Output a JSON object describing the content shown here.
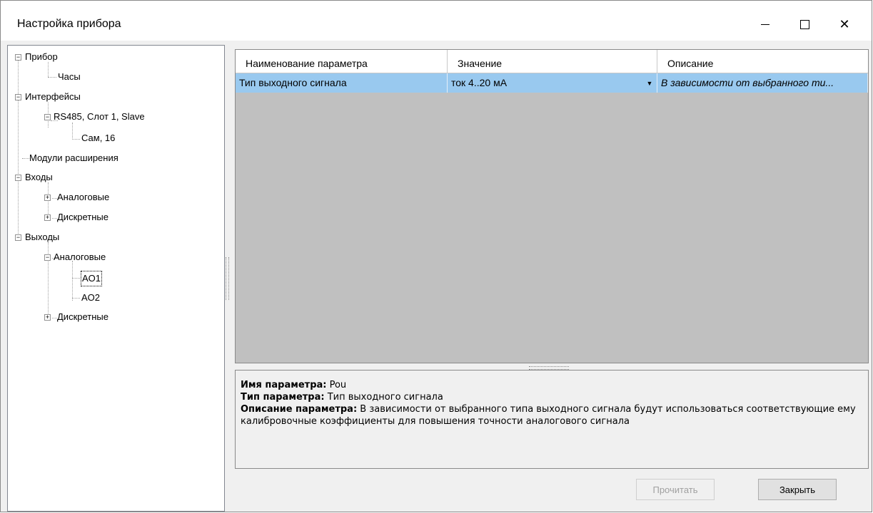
{
  "window": {
    "title": "Настройка прибора"
  },
  "tree": [
    {
      "label": "Прибор",
      "expander": "−"
    },
    {
      "label": "Часы"
    },
    {
      "label": "Интерфейсы",
      "expander": "−"
    },
    {
      "label": "RS485, Слот 1, Slave",
      "expander": "−"
    },
    {
      "label": "Сам, 16"
    },
    {
      "label": "Модули расширения"
    },
    {
      "label": "Входы",
      "expander": "−"
    },
    {
      "label": "Аналоговые",
      "expander": "+"
    },
    {
      "label": "Дискретные",
      "expander": "+"
    },
    {
      "label": "Выходы",
      "expander": "−"
    },
    {
      "label": "Аналоговые",
      "expander": "−"
    },
    {
      "label": "AO1",
      "selected": true
    },
    {
      "label": "AO2"
    },
    {
      "label": "Дискретные",
      "expander": "+"
    }
  ],
  "grid": {
    "columns": [
      "Наименование параметра",
      "Значение",
      "Описание"
    ],
    "rows": [
      {
        "name": "Тип выходного сигнала",
        "value": "ток 4..20 мА",
        "description": "В зависимости от выбранного ти..."
      }
    ],
    "dropdown_glyph": "▼"
  },
  "details": {
    "name_label": "Имя параметра:",
    "name_value": " Pou",
    "type_label": "Тип параметра:",
    "type_value": " Тип выходного сигнала",
    "desc_label": "Описание параметра:",
    "desc_value": " В зависимости от выбранного типа выходного сигнала будут использоваться соответствующие ему калибровочные коэффициенты для повышения точности аналогового сигнала"
  },
  "buttons": {
    "read": "Прочитать",
    "close": "Закрыть"
  },
  "window_controls": {
    "close_glyph": "✕"
  }
}
